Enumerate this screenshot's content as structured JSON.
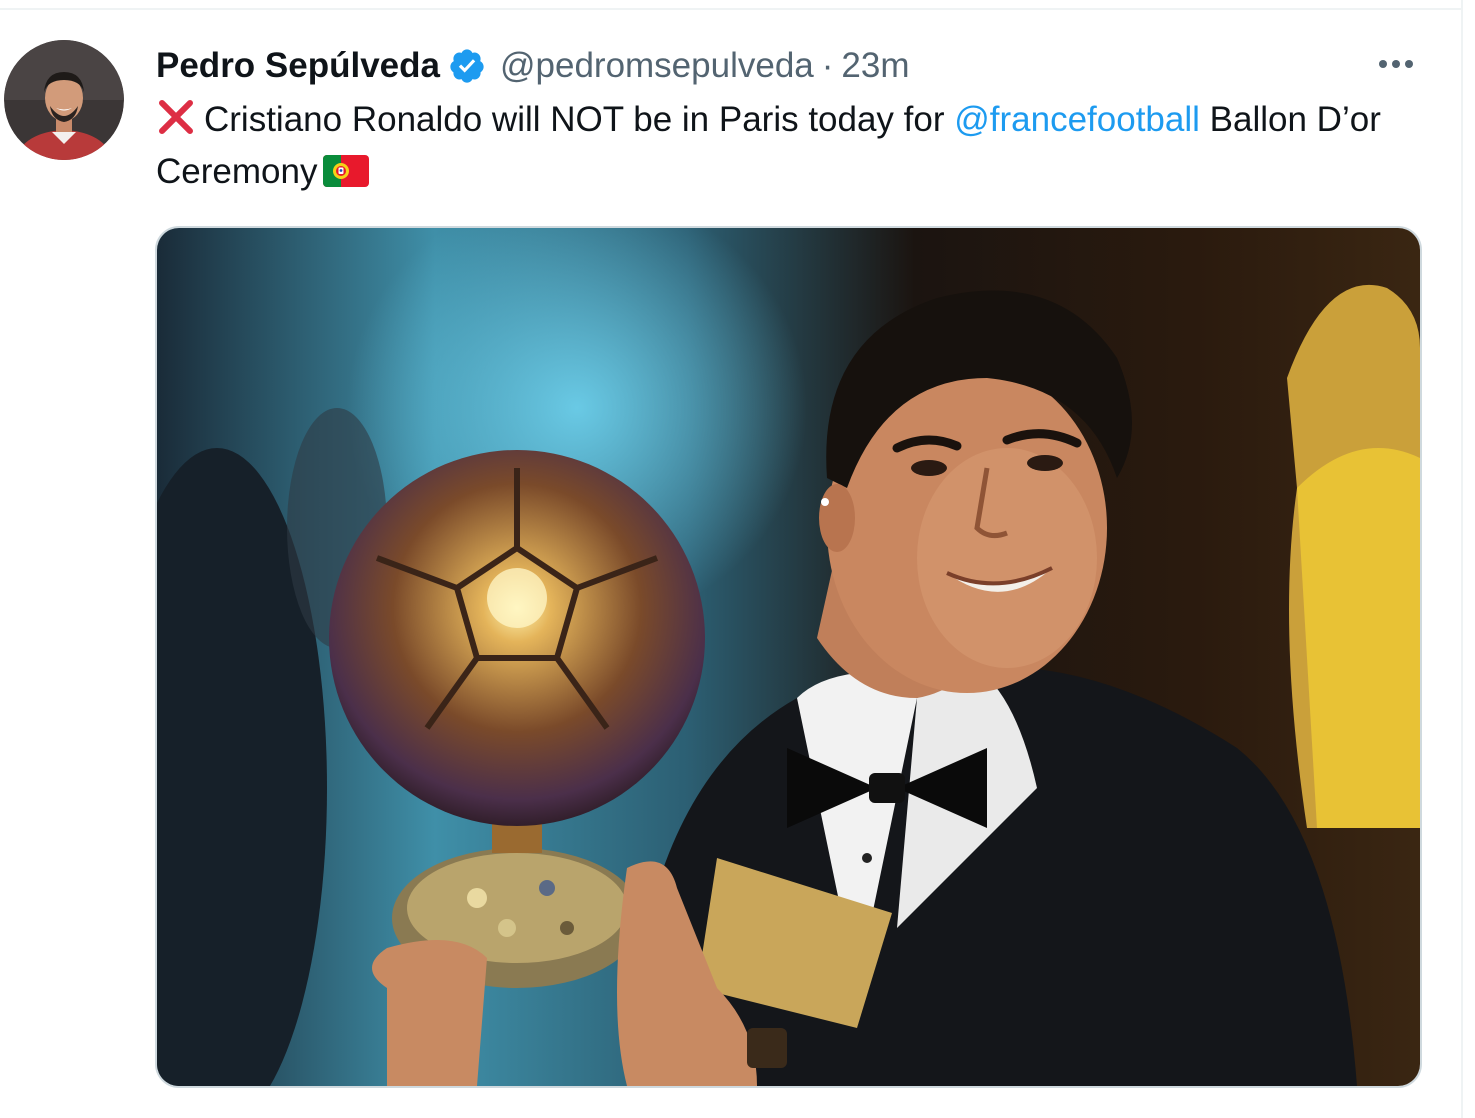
{
  "tweet": {
    "author": {
      "display_name": "Pedro Sepúlveda",
      "handle": "@pedromsepulveda",
      "verified": true,
      "avatar_icon": "avatar"
    },
    "separator": "·",
    "timestamp": "23m",
    "more_icon": "more-horizontal-icon",
    "text": {
      "prefix_emoji": "cross-mark-icon",
      "part1": "Cristiano Ronaldo will NOT be in Paris today for",
      "mention": "@francefootball",
      "part2": "Ballon D’or Ceremony",
      "suffix_emoji": "portugal-flag-icon"
    },
    "media": {
      "type": "photo"
    }
  },
  "colors": {
    "text": "#0f1419",
    "secondary": "#536471",
    "link": "#1d9bf0",
    "verified": "#1d9bf0",
    "border": "#cfd9de"
  }
}
